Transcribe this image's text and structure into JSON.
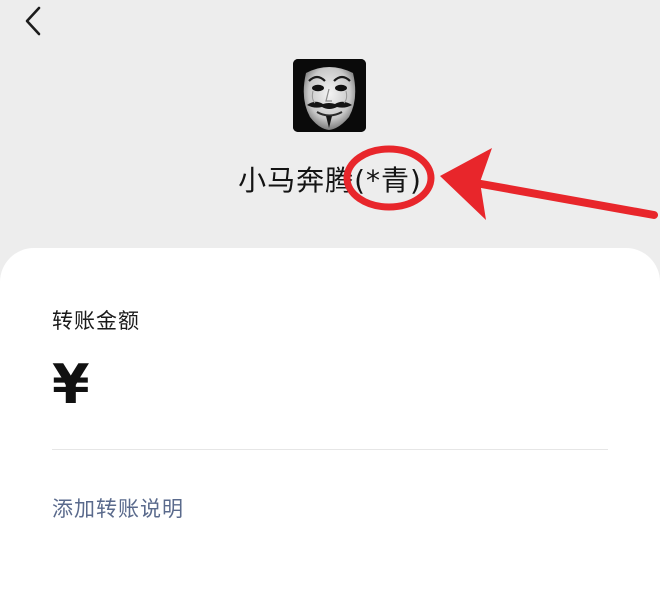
{
  "header": {
    "back_icon": "chevron-left-icon",
    "avatar_icon": "guy-fawkes-mask-avatar",
    "recipient_name": "小马奔腾(*青)"
  },
  "transfer": {
    "amount_label": "转账金额",
    "currency_symbol": "¥",
    "amount_value": "",
    "add_note_label": "添加转账说明"
  },
  "annotation": {
    "highlight_color": "#e8262b"
  },
  "colors": {
    "background": "#ededed",
    "card": "#ffffff",
    "link": "#5a6a8c"
  }
}
